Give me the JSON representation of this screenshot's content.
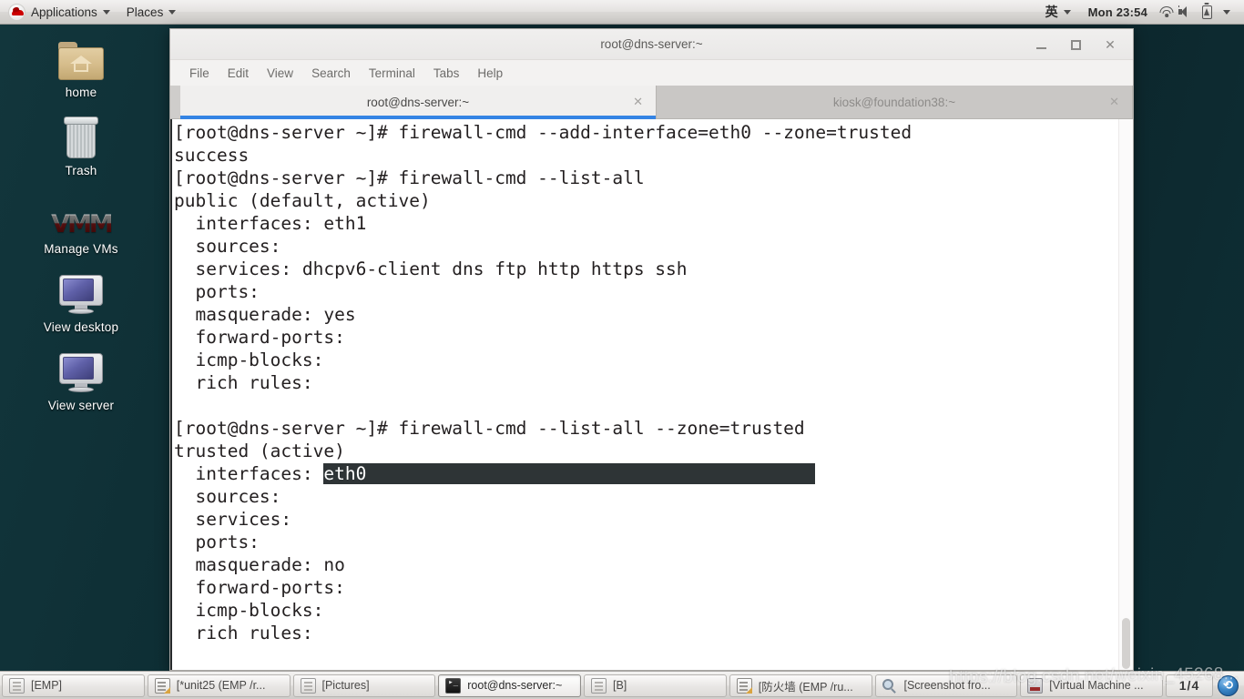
{
  "top_panel": {
    "logo_icon": "redhat-logo-icon",
    "applications_label": "Applications",
    "places_label": "Places",
    "ime_label": "英",
    "clock": "Mon 23:54",
    "tray_icons": [
      "wifi-icon",
      "volume-icon",
      "battery-icon",
      "chevron-down-icon"
    ]
  },
  "desktop": {
    "icons": [
      {
        "name": "home",
        "label": "home",
        "icon": "folder-home-icon"
      },
      {
        "name": "trash",
        "label": "Trash",
        "icon": "trash-bin-icon"
      },
      {
        "name": "manage-vms",
        "label": "Manage VMs",
        "icon": "vm-logo-icon"
      },
      {
        "name": "view-desktop",
        "label": "View desktop",
        "icon": "monitor-icon"
      },
      {
        "name": "view-server",
        "label": "View server",
        "icon": "monitor-icon"
      }
    ],
    "background_color": "#0c2a30",
    "watermark": "https://blog.csdn.net/weixin_45268..."
  },
  "terminal_window": {
    "title": "root@dns-server:~",
    "controls": {
      "minimize": "_",
      "maximize": "□",
      "close": "✕"
    },
    "menu": [
      "File",
      "Edit",
      "View",
      "Search",
      "Terminal",
      "Tabs",
      "Help"
    ],
    "tabs": [
      {
        "label": "root@dns-server:~",
        "active": true,
        "close": "✕"
      },
      {
        "label": "kiosk@foundation38:~",
        "active": false,
        "close": "✕"
      }
    ],
    "lines": [
      {
        "text": "[root@dns-server ~]# firewall-cmd --add-interface=eth0 --zone=trusted"
      },
      {
        "text": "success"
      },
      {
        "text": "[root@dns-server ~]# firewall-cmd --list-all"
      },
      {
        "text": "public (default, active)"
      },
      {
        "text": "  interfaces: eth1"
      },
      {
        "text": "  sources:"
      },
      {
        "text": "  services: dhcpv6-client dns ftp http https ssh"
      },
      {
        "text": "  ports:"
      },
      {
        "text": "  masquerade: yes"
      },
      {
        "text": "  forward-ports:"
      },
      {
        "text": "  icmp-blocks:"
      },
      {
        "text": "  rich rules:"
      },
      {
        "text": ""
      },
      {
        "text": "[root@dns-server ~]# firewall-cmd --list-all --zone=trusted"
      },
      {
        "text": "trusted (active)"
      },
      {
        "prefix": "  interfaces: ",
        "selected": "eth0",
        "selection_fill": 42
      },
      {
        "text": "  sources:"
      },
      {
        "text": "  services:"
      },
      {
        "text": "  ports:"
      },
      {
        "text": "  masquerade: no"
      },
      {
        "text": "  forward-ports:"
      },
      {
        "text": "  icmp-blocks:"
      },
      {
        "text": "  rich rules:"
      }
    ],
    "selection_bg": "#2e3436",
    "selection_fg": "#ffffff",
    "accent_color": "#3584e4"
  },
  "taskbar": {
    "items": [
      {
        "label": "[EMP]",
        "icon": "window-icon",
        "active": false
      },
      {
        "label": "[*unit25 (EMP /r...",
        "icon": "text-editor-icon",
        "active": false
      },
      {
        "label": "[Pictures]",
        "icon": "window-icon",
        "active": false
      },
      {
        "label": "root@dns-server:~",
        "icon": "terminal-icon",
        "active": true
      },
      {
        "label": "[B]",
        "icon": "window-icon",
        "active": false
      },
      {
        "label": "[防火墙 (EMP /ru...",
        "icon": "text-editor-icon",
        "active": false
      },
      {
        "label": "[Screenshot fro...",
        "icon": "screenshot-icon",
        "active": false
      },
      {
        "label": "[Virtual Machine ...",
        "icon": "virtual-machine-icon",
        "active": false
      }
    ],
    "workspace": "1/4",
    "tray_app_icon": "app-circle-icon",
    "tray_app_glyph": "⟲"
  }
}
